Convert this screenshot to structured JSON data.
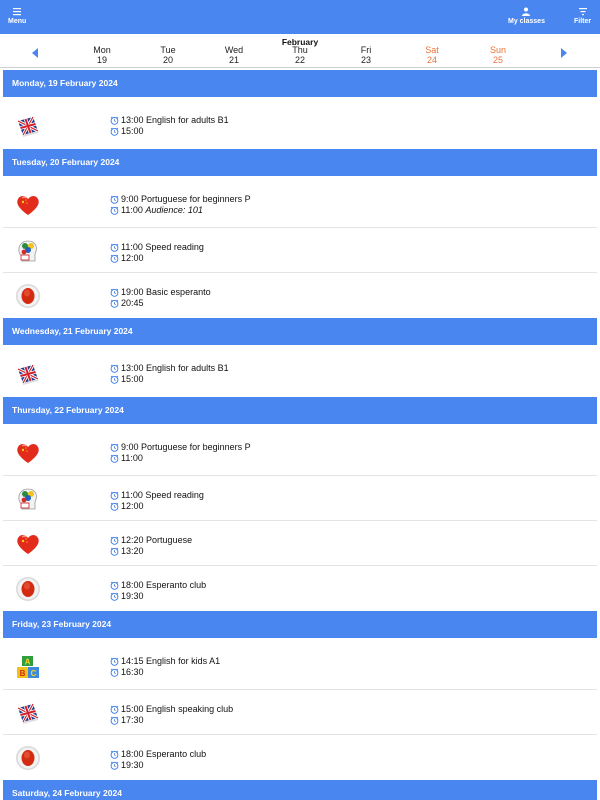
{
  "appbar": {
    "menu_label": "Menu",
    "myclasses_label": "My classes",
    "filter_label": "Filter",
    "color": "#4a86f0"
  },
  "week": {
    "month": "February",
    "days": [
      {
        "name": "Mon",
        "num": "19",
        "weekend": false
      },
      {
        "name": "Tue",
        "num": "20",
        "weekend": false
      },
      {
        "name": "Wed",
        "num": "21",
        "weekend": false
      },
      {
        "name": "Thu",
        "num": "22",
        "weekend": false
      },
      {
        "name": "Fri",
        "num": "23",
        "weekend": false
      },
      {
        "name": "Sat",
        "num": "24",
        "weekend": true
      },
      {
        "name": "Sun",
        "num": "25",
        "weekend": true
      }
    ]
  },
  "schedule": [
    {
      "date": "Monday, 19 February 2024",
      "classes": [
        {
          "icon": "uk-flag-book-icon",
          "start": "13:00",
          "title": "English for adults B1",
          "end": "15:00",
          "note": ""
        }
      ]
    },
    {
      "date": "Tuesday, 20 February 2024",
      "classes": [
        {
          "icon": "heart-icon",
          "start": "9:00",
          "title": "Portuguese for beginners P",
          "end": "11:00",
          "note": "Audience: 101"
        },
        {
          "icon": "speed-reading-head-icon",
          "start": "11:00",
          "title": "Speed reading",
          "end": "12:00",
          "note": ""
        },
        {
          "icon": "red-button-icon",
          "start": "19:00",
          "title": "Basic esperanto",
          "end": "20:45",
          "note": ""
        }
      ]
    },
    {
      "date": "Wednesday, 21 February 2024",
      "classes": [
        {
          "icon": "uk-flag-book-icon",
          "start": "13:00",
          "title": "English for adults B1",
          "end": "15:00",
          "note": ""
        }
      ]
    },
    {
      "date": "Thursday, 22 February 2024",
      "classes": [
        {
          "icon": "heart-icon",
          "start": "9:00",
          "title": "Portuguese for beginners P",
          "end": "11:00",
          "note": ""
        },
        {
          "icon": "speed-reading-head-icon",
          "start": "11:00",
          "title": "Speed reading",
          "end": "12:00",
          "note": ""
        },
        {
          "icon": "heart-icon",
          "start": "12:20",
          "title": "Portuguese",
          "end": "13:20",
          "note": ""
        },
        {
          "icon": "red-button-icon",
          "start": "18:00",
          "title": "Esperanto club",
          "end": "19:30",
          "note": ""
        }
      ]
    },
    {
      "date": "Friday, 23 February 2024",
      "classes": [
        {
          "icon": "abc-blocks-icon",
          "start": "14:15",
          "title": "English for kids A1",
          "end": "16:30",
          "note": ""
        },
        {
          "icon": "uk-flag-book-icon",
          "start": "15:00",
          "title": "English speaking club",
          "end": "17:30",
          "note": ""
        },
        {
          "icon": "red-button-icon",
          "start": "18:00",
          "title": "Esperanto club",
          "end": "19:30",
          "note": ""
        }
      ]
    },
    {
      "date": "Saturday, 24 February 2024",
      "classes": []
    }
  ]
}
